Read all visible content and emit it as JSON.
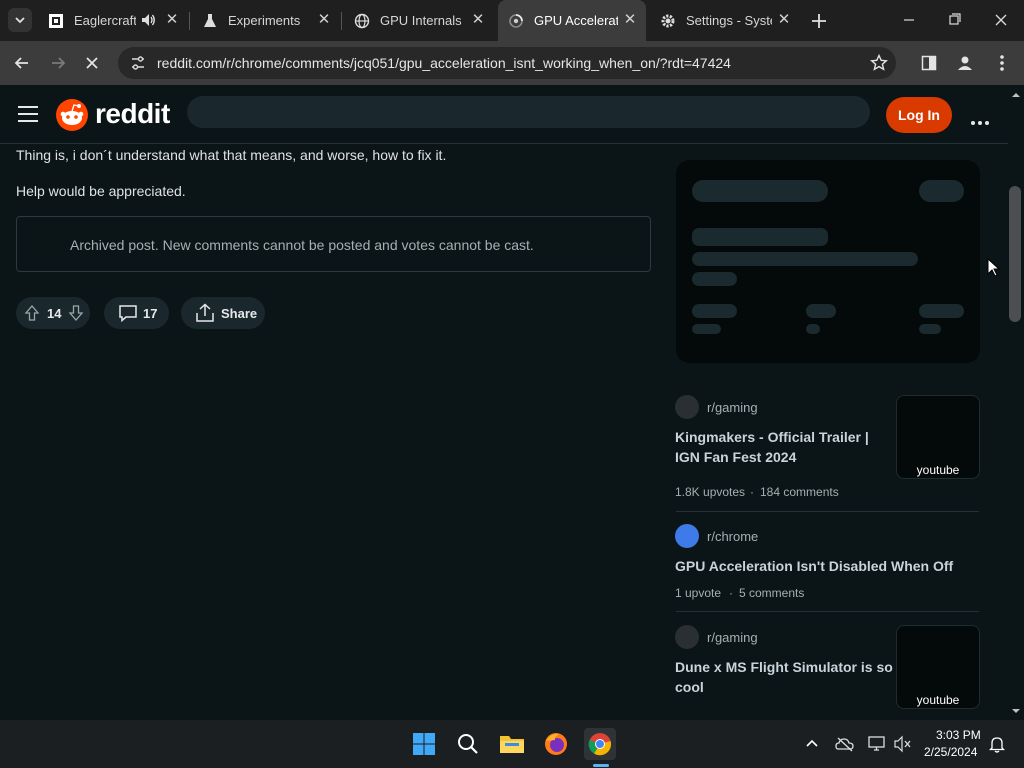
{
  "browser": {
    "tabs": [
      {
        "title": "Eaglercraft",
        "icon": "eaglercraft-icon",
        "active": false
      },
      {
        "title": "Experiments",
        "icon": "flask-icon",
        "active": false
      },
      {
        "title": "GPU Internals",
        "icon": "globe-icon",
        "active": false
      },
      {
        "title": "GPU Acceleratio",
        "icon": "reddit-loading-icon",
        "active": true
      },
      {
        "title": "Settings - Syste",
        "icon": "gear-icon",
        "active": false
      }
    ],
    "url": "reddit.com/r/chrome/comments/jcq051/gpu_acceleration_isnt_working_when_on/?rdt=47424"
  },
  "reddit": {
    "logo_text": "reddit",
    "login_label": "Log In",
    "post": {
      "line1": "Thing is, i don´t understand what that means, and worse, how to fix it.",
      "line2": "Help would be appreciated.",
      "archived_notice": "Archived post. New comments cannot be posted and votes cannot be cast.",
      "votes": "14",
      "comments": "17",
      "share_label": "Share"
    },
    "related": [
      {
        "subreddit": "r/gaming",
        "title_line1": "Kingmakers - Official Trailer |",
        "title_line2": "IGN Fan Fest 2024",
        "upvotes": "1.8K upvotes",
        "comments": "184 comments",
        "thumb_label": "youtube",
        "dot_color": "#2a2f31"
      },
      {
        "subreddit": "r/chrome",
        "title_line1": "GPU Acceleration Isn't Disabled When Off",
        "upvotes": "1 upvote",
        "comments": "5 comments",
        "dot_color": "#3f7be8"
      },
      {
        "subreddit": "r/gaming",
        "title_line1": "Dune x MS Flight Simulator is so",
        "title_line2": "cool",
        "thumb_label": "youtube",
        "dot_color": "#2a2f31"
      }
    ],
    "meta_separator": "·"
  },
  "taskbar": {
    "time": "3:03 PM",
    "date": "2/25/2024"
  },
  "colors": {
    "accent": "#d93a00",
    "bg": "#0b1416"
  }
}
